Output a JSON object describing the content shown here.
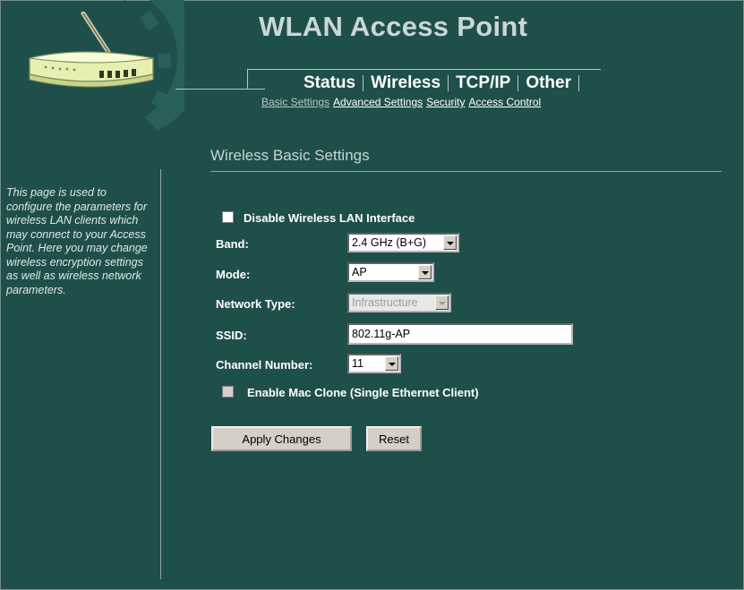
{
  "app": {
    "title": "WLAN Access Point"
  },
  "colors": {
    "background": "#1f4f4b",
    "accent": "#ffffff",
    "muted_text": "#c7d3d3"
  },
  "nav": {
    "tabs": [
      {
        "label": "Status"
      },
      {
        "label": "Wireless"
      },
      {
        "label": "TCP/IP"
      },
      {
        "label": "Other"
      }
    ],
    "subnav": [
      {
        "label": "Basic Settings",
        "active": true
      },
      {
        "label": "Advanced Settings"
      },
      {
        "label": "Security"
      },
      {
        "label": "Access Control"
      }
    ]
  },
  "page": {
    "title": "Wireless Basic Settings",
    "description": "This page is used to configure the parameters for wireless LAN clients which may connect to your Access Point. Here you may change wireless encryption settings as well as wireless network parameters."
  },
  "form": {
    "disable_wlan": {
      "label": "Disable Wireless LAN Interface",
      "checked": false
    },
    "band": {
      "label": "Band:",
      "value": "2.4 GHz (B+G)"
    },
    "mode": {
      "label": "Mode:",
      "value": "AP"
    },
    "network_type": {
      "label": "Network Type:",
      "value": "Infrastructure",
      "disabled": true
    },
    "ssid": {
      "label": "SSID:",
      "value": "802.11g-AP"
    },
    "channel": {
      "label": "Channel Number:",
      "value": "11"
    },
    "mac_clone": {
      "label": "Enable Mac Clone (Single Ethernet Client)",
      "checked": false,
      "disabled": true
    }
  },
  "buttons": {
    "apply": "Apply Changes",
    "reset": "Reset"
  },
  "icons": {
    "logo": "router-icon",
    "decoration": "gear-icon"
  }
}
